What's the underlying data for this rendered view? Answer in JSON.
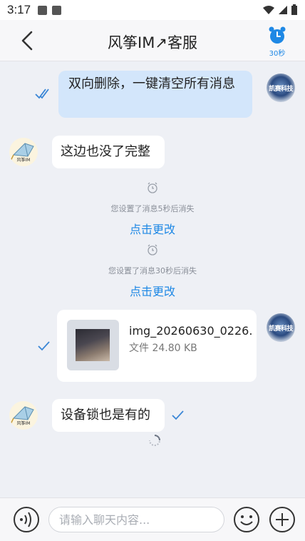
{
  "status_bar": {
    "time": "3:17"
  },
  "header": {
    "title": "风筝IM↗客服",
    "timer_label": "30秒"
  },
  "avatars": {
    "tech_text": "凯赛科技",
    "kite_text": "风筝IM"
  },
  "messages": [
    {
      "text": "双向删除，一键清空所有消息"
    },
    {
      "text": "这边也没了完整"
    },
    {
      "text": "设备锁也是有的"
    }
  ],
  "system": [
    {
      "text": "您设置了消息5秒后消失",
      "link": "点击更改"
    },
    {
      "text": "您设置了消息30秒后消失",
      "link": "点击更改"
    }
  ],
  "file": {
    "name": "img_20260630_0226...",
    "size": "文件 24.80 KB"
  },
  "input": {
    "placeholder": "请输入聊天内容..."
  },
  "colors": {
    "accent": "#1e88e5",
    "bubble_out": "#d3e6fb",
    "background": "#eef0f5"
  }
}
